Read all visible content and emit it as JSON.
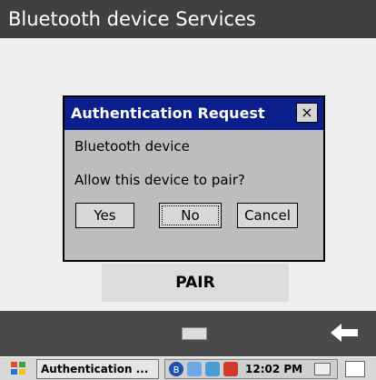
{
  "window": {
    "title": "Bluetooth device Services"
  },
  "main": {
    "pair_label": "PAIR"
  },
  "dialog": {
    "title": "Authentication Request",
    "close_label": "×",
    "line1": "Bluetooth device",
    "line2": "Allow this device to pair?",
    "buttons": {
      "yes": "Yes",
      "no": "No",
      "cancel": "Cancel"
    }
  },
  "taskbar": {
    "task_label": "Authentication ...",
    "clock": "12:02 PM",
    "bluetooth_glyph": "ʙ"
  },
  "icons": {
    "start": "windows-start-icon",
    "keyboard": "keyboard-icon",
    "back": "back-arrow-icon"
  },
  "colors": {
    "titlebar": "#404040",
    "dialog_title": "#0a1e8c",
    "bottombar": "#4a4a4a",
    "taskbar": "#d8d8d8"
  }
}
